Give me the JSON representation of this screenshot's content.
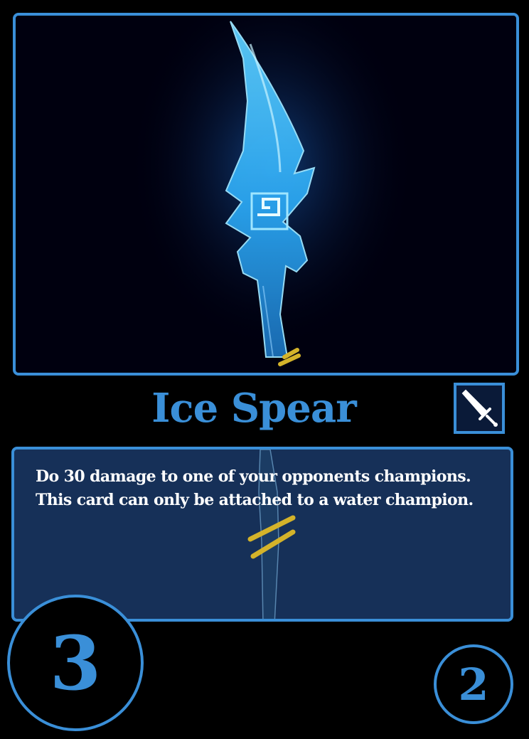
{
  "card": {
    "name": "Ice Spear",
    "type_icon": "sword-icon",
    "ability_lines": [
      "Do 30 damage to one of your opponents champions.",
      "This card can only be attached to a water champion."
    ],
    "cost": "3",
    "power": "2"
  },
  "colors": {
    "accent": "#3a8fd8",
    "background": "#000000",
    "text_box": "#163058",
    "ability_text": "#ffffff",
    "spear_glow": "#4fc3ff",
    "wrap_gold": "#d4b32a"
  }
}
